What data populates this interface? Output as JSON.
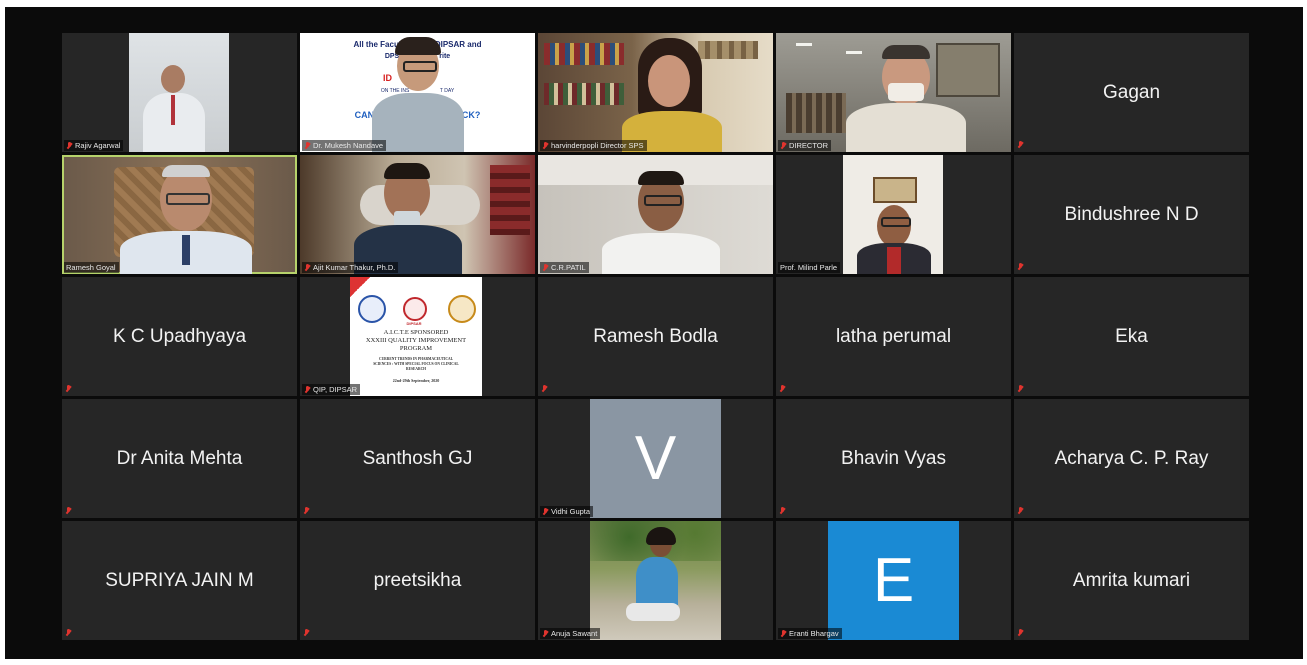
{
  "tiles": [
    {
      "name": "Rajiv Agarwal",
      "kind": "video"
    },
    {
      "name": "Dr. Mukesh Nandave",
      "kind": "video",
      "slide_lines": [
        "All the Faculty",
        "DIPSAR and",
        "DPSR",
        "rite",
        "ID",
        "ON THE INS",
        "T DAY",
        "CAN WE HA",
        "ATTACK?"
      ]
    },
    {
      "name": "harvinderpopli Director SPS",
      "kind": "video"
    },
    {
      "name": "DIRECTOR",
      "kind": "video"
    },
    {
      "name": "Gagan",
      "kind": "name"
    },
    {
      "name": "Ramesh Goyal",
      "kind": "video"
    },
    {
      "name": "Ajit Kumar Thakur, Ph.D.",
      "kind": "video"
    },
    {
      "name": "C.R.PATIL",
      "kind": "video"
    },
    {
      "name": "Prof. Milind Parle",
      "kind": "video"
    },
    {
      "name": "Bindushree N D",
      "kind": "name"
    },
    {
      "name": "K C Upadhyaya",
      "kind": "name"
    },
    {
      "name": "QIP, DIPSAR",
      "kind": "poster",
      "poster": {
        "logo_mid": "DIPSAR",
        "line1": "A.I.C.T.E SPONSORED",
        "line2": "XXXIII QUALITY IMPROVEMENT",
        "line3": "PROGRAM",
        "line4": "CURRENT TRENDS IN PHARMACEUTICAL",
        "line5": "SCIENCES : WITH SPECIAL FOCUS ON CLINICAL",
        "line6": "RESEARCH",
        "dates": "22nd-29th September, 2020"
      }
    },
    {
      "name": "Ramesh Bodla",
      "kind": "name"
    },
    {
      "name": "latha perumal",
      "kind": "name"
    },
    {
      "name": "Eka",
      "kind": "name"
    },
    {
      "name": "Dr Anita Mehta",
      "kind": "name"
    },
    {
      "name": "Santhosh GJ",
      "kind": "name"
    },
    {
      "name": "Vidhi Gupta",
      "kind": "avatar",
      "letter": "V",
      "color": "#8a96a3"
    },
    {
      "name": "Bhavin Vyas",
      "kind": "name"
    },
    {
      "name": "Acharya C. P. Ray",
      "kind": "name"
    },
    {
      "name": "SUPRIYA JAIN M",
      "kind": "name"
    },
    {
      "name": "preetsikha",
      "kind": "name"
    },
    {
      "name": "Anuja Sawant",
      "kind": "video"
    },
    {
      "name": "Eranti Bhargav",
      "kind": "avatar",
      "letter": "E",
      "color": "#1a8ad4"
    },
    {
      "name": "Amrita kumari",
      "kind": "name"
    }
  ],
  "colors": {
    "active_speaker_border": "#b6d26b",
    "muted_mic": "#e0342e",
    "tile_bg": "#262626"
  }
}
